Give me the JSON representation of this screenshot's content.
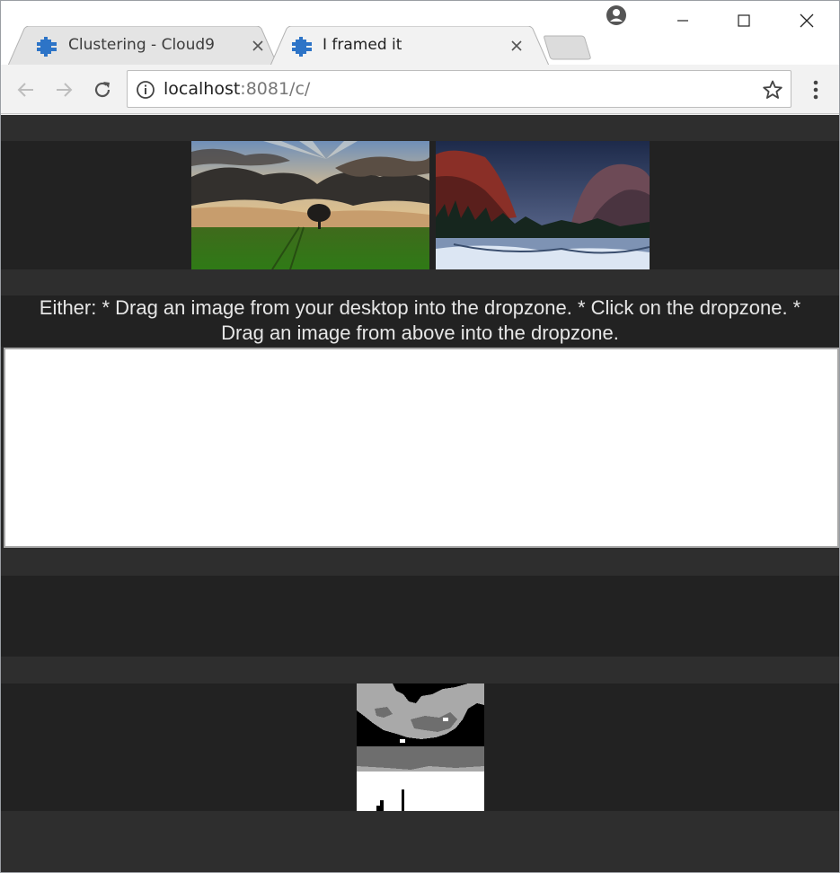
{
  "browser": {
    "tabs": [
      {
        "title": "Clustering - Cloud9",
        "active": false,
        "favicon": "cloud9-icon"
      },
      {
        "title": "I framed it",
        "active": true,
        "favicon": "cloud9-icon"
      }
    ],
    "address": {
      "host": "localhost",
      "path": ":8081/c/"
    }
  },
  "page": {
    "gallery": {
      "images": [
        {
          "name": "sunset-tree-field-image",
          "description": "tree under dramatic sky"
        },
        {
          "name": "mountain-cliffs-snow-image",
          "description": "mountain cliffs and snowy river"
        }
      ]
    },
    "instructions": {
      "line1": "Either: * Drag an image from your desktop into the dropzone. * Click on the dropzone. *",
      "line2": "Drag an image from above into the dropzone."
    }
  },
  "colors": {
    "page_bg": "#2a2a2a",
    "band_dark": "#222222",
    "band_light": "#2e2e2e",
    "text": "#e6e6e6",
    "accent_favicon": "#2d74c7"
  }
}
